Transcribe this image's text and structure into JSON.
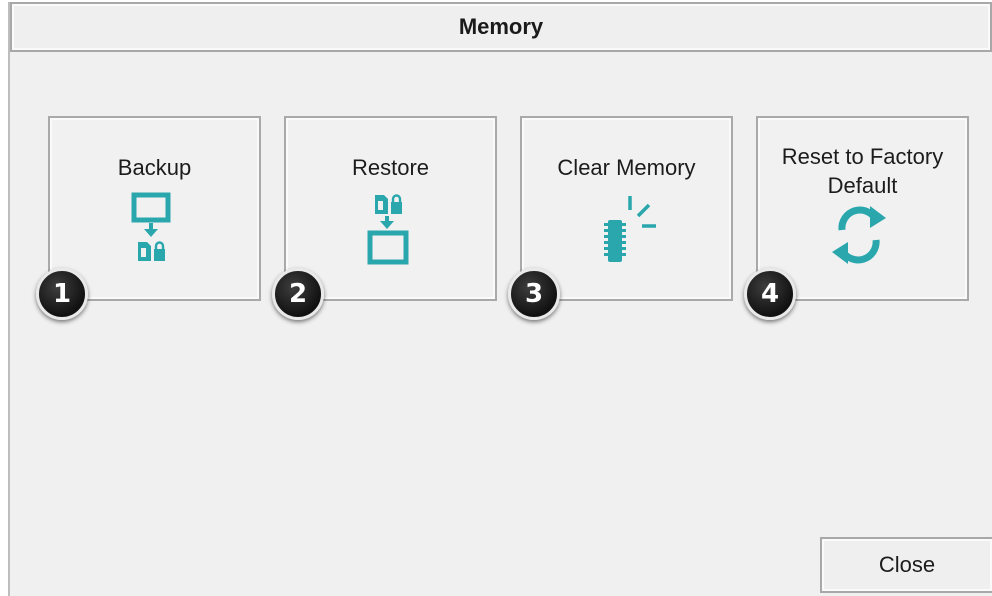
{
  "window": {
    "title": "Memory"
  },
  "tiles": [
    {
      "label": "Backup",
      "icon": "backup-icon",
      "badge": "1"
    },
    {
      "label": "Restore",
      "icon": "restore-icon",
      "badge": "2"
    },
    {
      "label": "Clear Memory",
      "icon": "clear-memory-icon",
      "badge": "3"
    },
    {
      "label": "Reset to Factory Default",
      "icon": "reset-icon",
      "badge": "4"
    }
  ],
  "footer": {
    "close_label": "Close"
  },
  "colors": {
    "accent": "#2aa7ad",
    "background": "#f0f0f0",
    "border": "#a8a8a8",
    "badge": "#1a1a1a"
  }
}
